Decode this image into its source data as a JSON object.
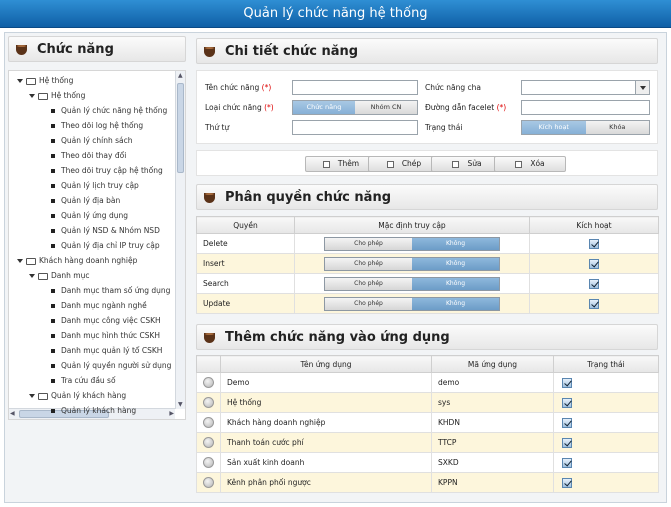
{
  "app": {
    "title": "Quản lý chức năng hệ thống"
  },
  "left": {
    "header": "Chức năng",
    "tree": [
      {
        "label": "Hệ thống",
        "level": 0,
        "kind": "folder"
      },
      {
        "label": "Hệ thống",
        "level": 1,
        "kind": "folder"
      },
      {
        "label": "Quản lý chức năng hệ thống",
        "level": 2,
        "kind": "leaf"
      },
      {
        "label": "Theo dõi log hệ thống",
        "level": 2,
        "kind": "leaf"
      },
      {
        "label": "Quản lý chính sách",
        "level": 2,
        "kind": "leaf"
      },
      {
        "label": "Theo dõi thay đổi",
        "level": 2,
        "kind": "leaf"
      },
      {
        "label": "Theo dõi truy cập hệ thống",
        "level": 2,
        "kind": "leaf"
      },
      {
        "label": "Quản lý lịch truy cập",
        "level": 2,
        "kind": "leaf"
      },
      {
        "label": "Quản lý địa bàn",
        "level": 2,
        "kind": "leaf"
      },
      {
        "label": "Quản lý ứng dụng",
        "level": 2,
        "kind": "leaf"
      },
      {
        "label": "Quản lý NSD & Nhóm NSD",
        "level": 2,
        "kind": "leaf"
      },
      {
        "label": "Quản lý địa chỉ IP truy cập",
        "level": 2,
        "kind": "leaf"
      },
      {
        "label": "Khách hàng doanh nghiệp",
        "level": 0,
        "kind": "folder"
      },
      {
        "label": "Danh mục",
        "level": 1,
        "kind": "folder"
      },
      {
        "label": "Danh mục tham số ứng dụng",
        "level": 2,
        "kind": "leaf"
      },
      {
        "label": "Danh mục ngành nghề",
        "level": 2,
        "kind": "leaf"
      },
      {
        "label": "Danh mục công việc CSKH",
        "level": 2,
        "kind": "leaf"
      },
      {
        "label": "Danh mục hình thức CSKH",
        "level": 2,
        "kind": "leaf"
      },
      {
        "label": "Danh mục quản lý tổ CSKH",
        "level": 2,
        "kind": "leaf"
      },
      {
        "label": "Quản lý quyền người sử dụng",
        "level": 2,
        "kind": "leaf"
      },
      {
        "label": "Tra cứu đầu số",
        "level": 2,
        "kind": "leaf"
      },
      {
        "label": "Quản lý khách hàng",
        "level": 1,
        "kind": "folder"
      },
      {
        "label": "Quản lý khách hàng",
        "level": 2,
        "kind": "leaf"
      }
    ]
  },
  "detail": {
    "header": "Chi tiết chức năng",
    "ten_chuc_nang": {
      "label": "Tên chức năng",
      "req": "(*)",
      "value": ""
    },
    "loai_chuc_nang": {
      "label": "Loại chức năng",
      "req": "(*)",
      "options": [
        "Chức năng",
        "Nhóm CN"
      ],
      "selected": "Chức năng"
    },
    "thu_tu": {
      "label": "Thứ tự",
      "value": ""
    },
    "chuc_nang_cha": {
      "label": "Chức năng cha",
      "value": ""
    },
    "duong_dan": {
      "label": "Đường dẫn facelet",
      "req": "(*)",
      "value": ""
    },
    "trang_thai": {
      "label": "Trạng thái",
      "options": [
        "Kích hoạt",
        "Khóa"
      ],
      "selected": "Kích hoạt"
    }
  },
  "actions": {
    "add": "Thêm",
    "copy": "Chép",
    "edit": "Sửa",
    "delete": "Xóa"
  },
  "perm": {
    "header": "Phân quyền chức năng",
    "columns": [
      "Quyền",
      "Mặc định truy cập",
      "Kích hoạt"
    ],
    "toggle": [
      "Cho phép",
      "Không"
    ],
    "rows": [
      {
        "name": "Delete",
        "default": "Không",
        "active": true
      },
      {
        "name": "Insert",
        "default": "Không",
        "active": true
      },
      {
        "name": "Search",
        "default": "Không",
        "active": true
      },
      {
        "name": "Update",
        "default": "Không",
        "active": true
      }
    ]
  },
  "apps": {
    "header": "Thêm chức năng vào ứng dụng",
    "columns": [
      "Tên ứng dụng",
      "Mã ứng dụng",
      "Trạng thái"
    ],
    "rows": [
      {
        "name": "Demo",
        "code": "demo",
        "status": true
      },
      {
        "name": "Hệ thống",
        "code": "sys",
        "status": true
      },
      {
        "name": "Khách hàng doanh nghiệp",
        "code": "KHDN",
        "status": true
      },
      {
        "name": "Thanh toán cước phí",
        "code": "TTCP",
        "status": true
      },
      {
        "name": "Sản xuất kinh doanh",
        "code": "SXKD",
        "status": true
      },
      {
        "name": "Kênh phân phối ngược",
        "code": "KPPN",
        "status": true
      }
    ]
  }
}
